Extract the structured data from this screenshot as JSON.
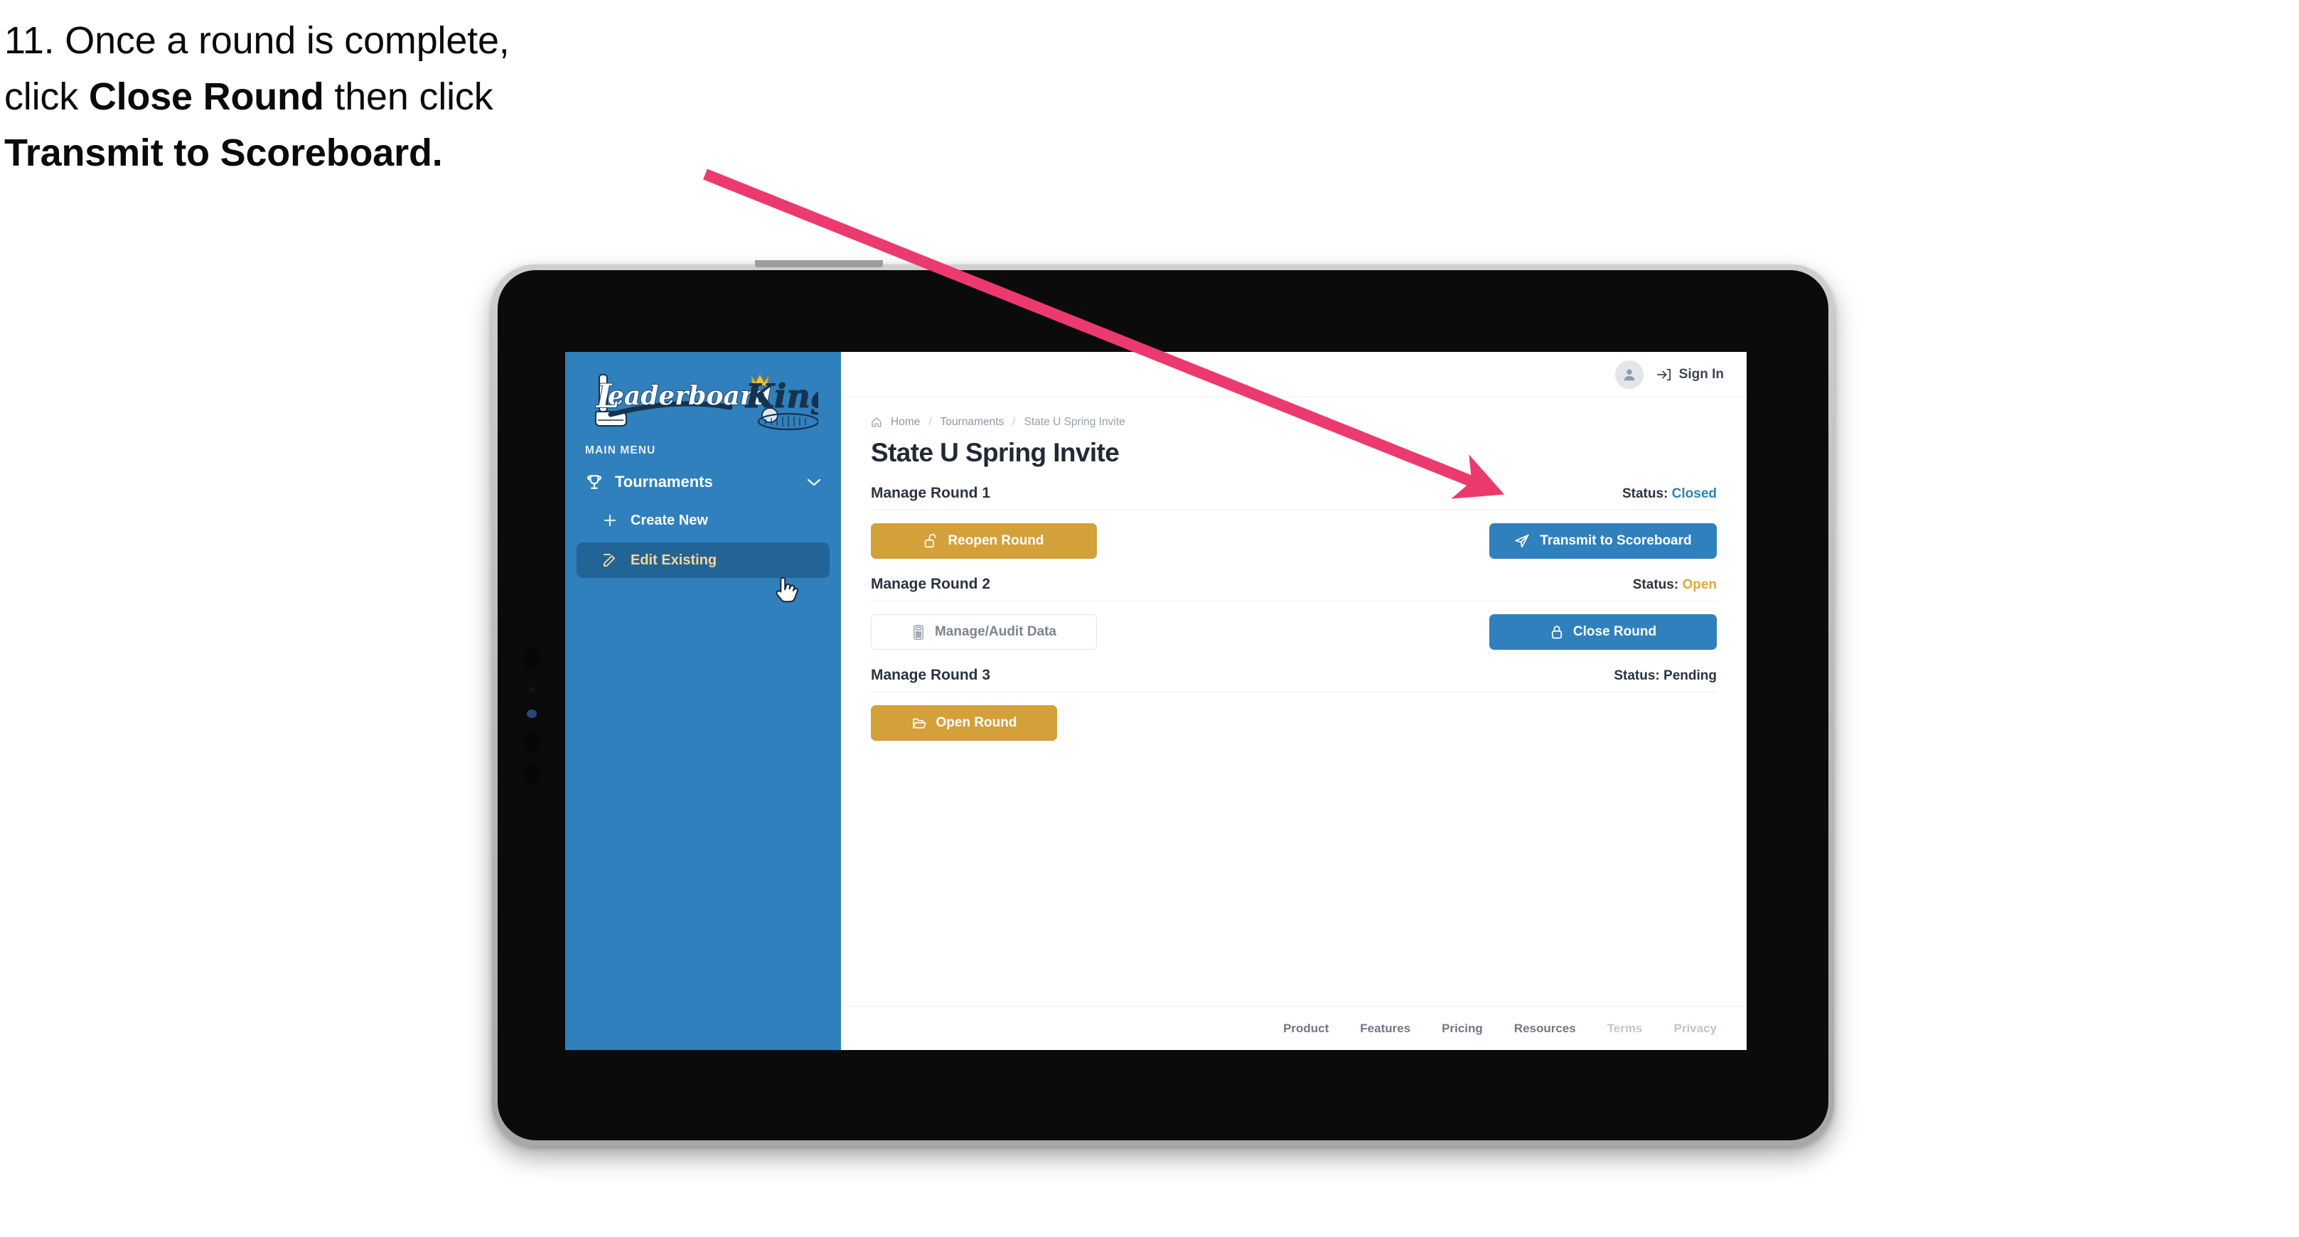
{
  "caption": {
    "line1_prefix": "11. Once a round is complete,",
    "line2_pre": "click ",
    "line2_bold": "Close Round",
    "line2_post": " then click",
    "line3_bold": "Transmit to Scoreboard."
  },
  "colors": {
    "arrow": "#ec3a6e",
    "sidebar_blue": "#2f80bd",
    "sidebar_active": "#226496",
    "sidebar_active_text": "#f3d79a",
    "button_gold": "#d4a03a",
    "button_blue": "#2f80bd",
    "status_closed": "#2f80bd",
    "status_open": "#e0a93c",
    "status_pending": "#2b3341",
    "page_title": "#222936"
  },
  "sidebar": {
    "logo_primary": "Leaderboard",
    "logo_secondary": "King",
    "section_label": "MAIN MENU",
    "nav": {
      "parent_label": "Tournaments",
      "parent_icon": "trophy-icon",
      "chevron_icon": "chevron-down-icon",
      "items": [
        {
          "label": "Create New",
          "icon": "plus-icon",
          "active": false
        },
        {
          "label": "Edit Existing",
          "icon": "edit-pencil-icon",
          "active": true
        }
      ]
    }
  },
  "topbar": {
    "avatar_icon": "user-avatar-icon",
    "signin_icon": "sign-in-arrow-icon",
    "signin_label": "Sign In"
  },
  "breadcrumb": {
    "home_icon": "home-icon",
    "items": [
      "Home",
      "Tournaments",
      "State U Spring Invite"
    ],
    "separator": "/"
  },
  "page": {
    "title": "State U Spring Invite"
  },
  "rounds": [
    {
      "name": "Manage Round 1",
      "status_label": "Status:",
      "status_value": "Closed",
      "status_kind": "closed",
      "left_button": {
        "label": "Reopen Round",
        "icon": "unlock-icon",
        "style": "gold"
      },
      "right_button": {
        "label": "Transmit to Scoreboard",
        "icon": "paper-plane-icon",
        "style": "blue"
      }
    },
    {
      "name": "Manage Round 2",
      "status_label": "Status:",
      "status_value": "Open",
      "status_kind": "open",
      "left_button": {
        "label": "Manage/Audit Data",
        "icon": "calculator-icon",
        "style": "ghost"
      },
      "right_button": {
        "label": "Close Round",
        "icon": "lock-icon",
        "style": "blue"
      }
    },
    {
      "name": "Manage Round 3",
      "status_label": "Status:",
      "status_value": "Pending",
      "status_kind": "pending",
      "left_button": {
        "label": "Open Round",
        "icon": "folder-open-icon",
        "style": "gold"
      },
      "right_button": null
    }
  ],
  "footer": {
    "links": [
      {
        "label": "Product",
        "dim": false
      },
      {
        "label": "Features",
        "dim": false
      },
      {
        "label": "Pricing",
        "dim": false
      },
      {
        "label": "Resources",
        "dim": false
      },
      {
        "label": "Terms",
        "dim": true
      },
      {
        "label": "Privacy",
        "dim": true
      }
    ]
  }
}
